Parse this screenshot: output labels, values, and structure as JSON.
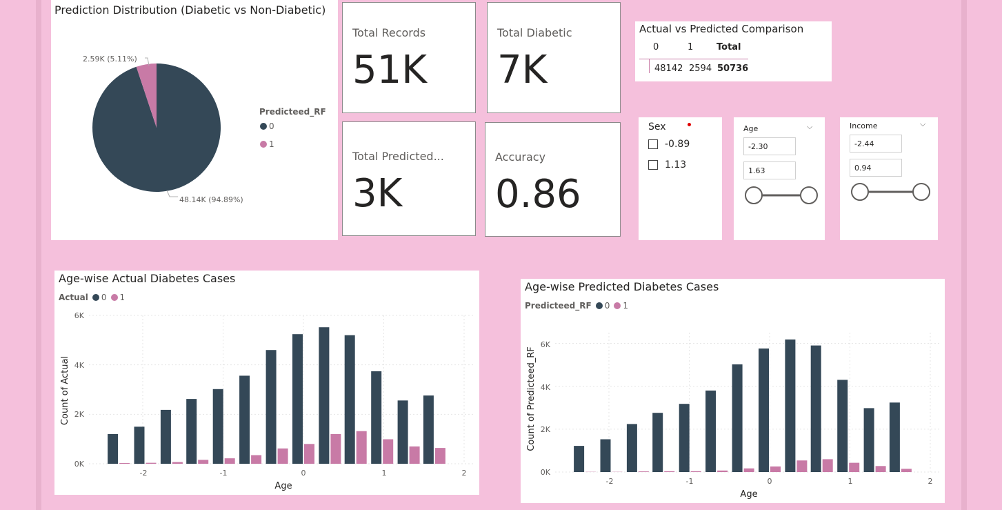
{
  "colors": {
    "dark": "#344857",
    "pink": "#c87aa6",
    "background": "#f5c0dc"
  },
  "pie": {
    "title": "Prediction Distribution (Diabetic vs Non-Diabetic)",
    "legend_title": "Predicteed_RF",
    "slices": [
      {
        "label": "0",
        "value": 48142,
        "data_label": "48.14K (94.89%)"
      },
      {
        "label": "1",
        "value": 2594,
        "data_label": "2.59K (5.11%)"
      }
    ]
  },
  "kpis": {
    "total_records": {
      "label": "Total Records",
      "value": "51K"
    },
    "total_diabetic": {
      "label": "Total Diabetic",
      "value": "7K"
    },
    "total_predicted": {
      "label": "Total Predicted...",
      "value": "3K"
    },
    "accuracy": {
      "label": "Accuracy",
      "value": "0.86"
    }
  },
  "matrix": {
    "title": "Actual vs Predicted Comparison",
    "headers": [
      "0",
      "1",
      "Total"
    ],
    "values": [
      "48142",
      "2594",
      "50736"
    ]
  },
  "slicers": {
    "sex": {
      "title": "Sex",
      "options": [
        "-0.89",
        "1.13"
      ]
    },
    "age": {
      "title": "Age",
      "min": "-2.30",
      "max": "1.63",
      "chevron": "⌵"
    },
    "income": {
      "title": "Income",
      "min": "-2.44",
      "max": "0.94",
      "chevron": "⌵"
    }
  },
  "chart_actual": {
    "title": "Age-wise Actual Diabetes Cases",
    "legend_title": "Actual",
    "legend_items": [
      "0",
      "1"
    ],
    "xlabel": "Age",
    "ylabel": "Count of Actual",
    "ytick_labels": [
      "0K",
      "2K",
      "4K",
      "6K"
    ],
    "xtick_labels": [
      "-2",
      "-1",
      "0",
      "1",
      "2"
    ]
  },
  "chart_pred": {
    "title": "Age-wise Predicted Diabetes Cases",
    "legend_title": "Predicteed_RF",
    "legend_items": [
      "0",
      "1"
    ],
    "xlabel": "Age",
    "ylabel": "Count of Predicteed_RF",
    "ytick_labels": [
      "0K",
      "2K",
      "4K",
      "6K"
    ],
    "xtick_labels": [
      "-2",
      "-1",
      "0",
      "1",
      "2"
    ]
  },
  "chart_data": [
    {
      "type": "bar",
      "title": "Age-wise Actual Diabetes Cases",
      "xlabel": "Age",
      "ylabel": "Count of Actual",
      "x": [
        -2.3,
        -1.97,
        -1.64,
        -1.32,
        -0.99,
        -0.66,
        -0.33,
        0.0,
        0.33,
        0.65,
        0.98,
        1.31,
        1.63
      ],
      "xlim": [
        -2.55,
        2.0
      ],
      "ylim": [
        0,
        6000
      ],
      "grid": true,
      "legend": "top-left",
      "series": [
        {
          "name": "0",
          "values": [
            1200,
            1500,
            2180,
            2620,
            3020,
            3560,
            4600,
            5240,
            5520,
            5200,
            3740,
            2560,
            2760
          ]
        },
        {
          "name": "1",
          "values": [
            30,
            40,
            70,
            160,
            220,
            350,
            620,
            800,
            1200,
            1320,
            990,
            700,
            640
          ]
        }
      ]
    },
    {
      "type": "bar",
      "title": "Age-wise Predicted Diabetes Cases",
      "xlabel": "Age",
      "ylabel": "Count of Predicteed_RF",
      "x": [
        -2.3,
        -1.97,
        -1.64,
        -1.32,
        -0.99,
        -0.66,
        -0.33,
        0.0,
        0.33,
        0.65,
        0.98,
        1.31,
        1.63
      ],
      "xlim": [
        -2.55,
        2.0
      ],
      "ylim": [
        0,
        6500
      ],
      "grid": true,
      "legend": "top-left",
      "series": [
        {
          "name": "0",
          "values": [
            1220,
            1530,
            2240,
            2760,
            3180,
            3800,
            5020,
            5760,
            6180,
            5900,
            4300,
            2980,
            3240
          ]
        },
        {
          "name": "1",
          "values": [
            10,
            10,
            30,
            40,
            40,
            70,
            170,
            260,
            540,
            600,
            430,
            280,
            150
          ]
        }
      ]
    }
  ]
}
